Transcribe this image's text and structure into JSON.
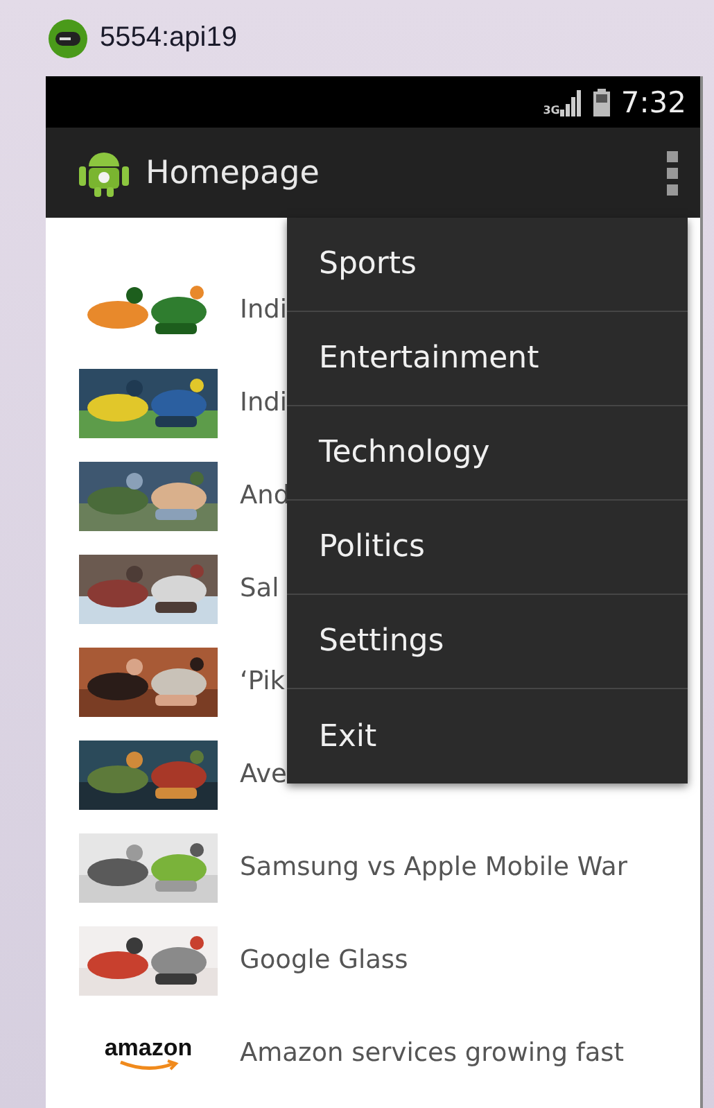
{
  "window": {
    "title": "5554:api19"
  },
  "status_bar": {
    "network": "3G",
    "time": "7:32"
  },
  "action_bar": {
    "title": "Homepage"
  },
  "list": [
    {
      "title": "Indi"
    },
    {
      "title": "Indi"
    },
    {
      "title": "And"
    },
    {
      "title": "Sal"
    },
    {
      "title": "‘Pik"
    },
    {
      "title": "Ave"
    },
    {
      "title": "Samsung vs Apple Mobile War"
    },
    {
      "title": "Google Glass"
    },
    {
      "title": "Amazon services growing fast",
      "thumb": {
        "kind": "logo",
        "text": "amazon"
      }
    }
  ],
  "menu": {
    "items": [
      "Sports",
      "Entertainment",
      "Technology",
      "Politics",
      "Settings",
      "Exit"
    ]
  }
}
